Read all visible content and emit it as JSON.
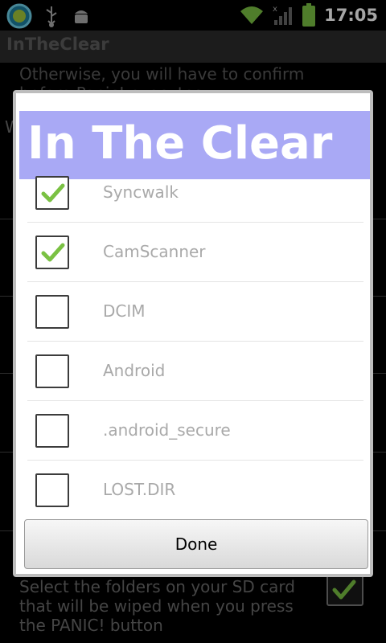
{
  "status_bar": {
    "time": "17:05",
    "icons": [
      "android-app-icon",
      "usb-icon",
      "android-debug-icon",
      "wifi-icon",
      "signal-icon",
      "battery-icon"
    ]
  },
  "app": {
    "title": "InTheClear"
  },
  "background": {
    "top_text": "Otherwise, you will have to confirm before Panic! executes",
    "partial_item": "W",
    "bottom_text": "Select the folders on your SD card that will be wiped when you press the PANIC! button",
    "bottom_checkbox_checked": true
  },
  "dialog": {
    "title": "In The Clear",
    "header_color": "#a9a9f5",
    "items": [
      {
        "label": "Syncwalk",
        "checked": true
      },
      {
        "label": "CamScanner",
        "checked": true
      },
      {
        "label": "DCIM",
        "checked": false
      },
      {
        "label": "Android",
        "checked": false
      },
      {
        "label": ".android_secure",
        "checked": false
      },
      {
        "label": "LOST.DIR",
        "checked": false
      }
    ],
    "done_label": "Done"
  },
  "colors": {
    "check_green": "#7ac143",
    "item_text": "#a9a9a9"
  }
}
